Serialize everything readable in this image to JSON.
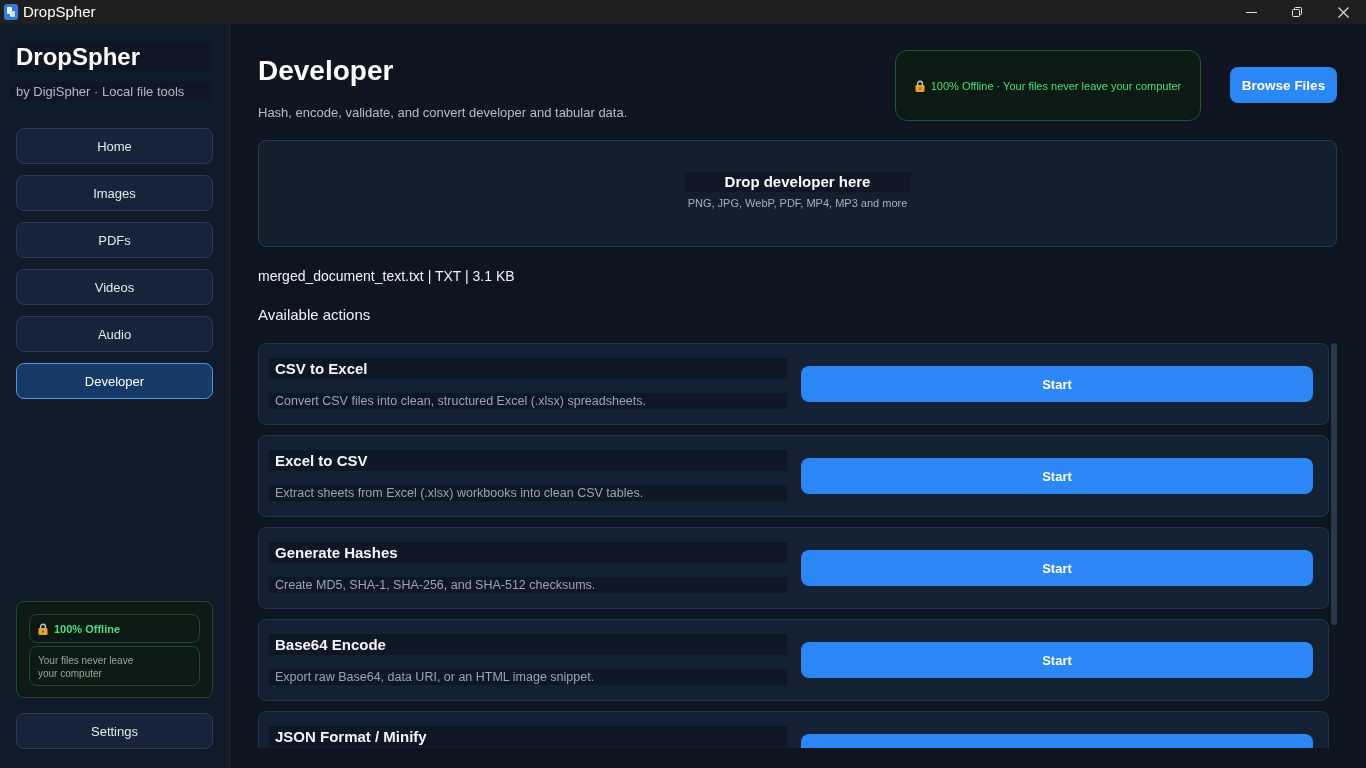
{
  "window": {
    "title": "DropSpher"
  },
  "sidebar": {
    "brand": "DropSpher",
    "tagline": "by DigiSpher · Local file tools",
    "nav": [
      {
        "label": "Home",
        "selected": false
      },
      {
        "label": "Images",
        "selected": false
      },
      {
        "label": "PDFs",
        "selected": false
      },
      {
        "label": "Videos",
        "selected": false
      },
      {
        "label": "Audio",
        "selected": false
      },
      {
        "label": "Developer",
        "selected": true
      }
    ],
    "offline_card": {
      "badge": "100% Offline",
      "note": "Your files never leave your computer"
    },
    "settings_button": "Settings"
  },
  "header": {
    "title": "Developer",
    "subtitle": "Hash, encode, validate, and convert developer and tabular data.",
    "offline_banner": "100% Offline · Your files never leave your computer",
    "browse_button": "Browse Files"
  },
  "drop_zone": {
    "title": "Drop developer here",
    "formats": "PNG, JPG, WebP, PDF, MP4, MP3 and more"
  },
  "file_info": "merged_document_text.txt | TXT | 3.1 KB",
  "actions": {
    "heading": "Available actions",
    "items": [
      {
        "title": "CSV to Excel",
        "description": "Convert CSV files into clean, structured Excel (.xlsx) spreadsheets.",
        "button": "Start"
      },
      {
        "title": "Excel to CSV",
        "description": "Extract sheets from Excel (.xlsx) workbooks into clean CSV tables.",
        "button": "Start"
      },
      {
        "title": "Generate Hashes",
        "description": "Create MD5, SHA-1, SHA-256, and SHA-512 checksums.",
        "button": "Start"
      },
      {
        "title": "Base64 Encode",
        "description": "Export raw Base64, data URI, or an HTML image snippet.",
        "button": "Start"
      },
      {
        "title": "JSON Format / Minify"
      }
    ]
  }
}
